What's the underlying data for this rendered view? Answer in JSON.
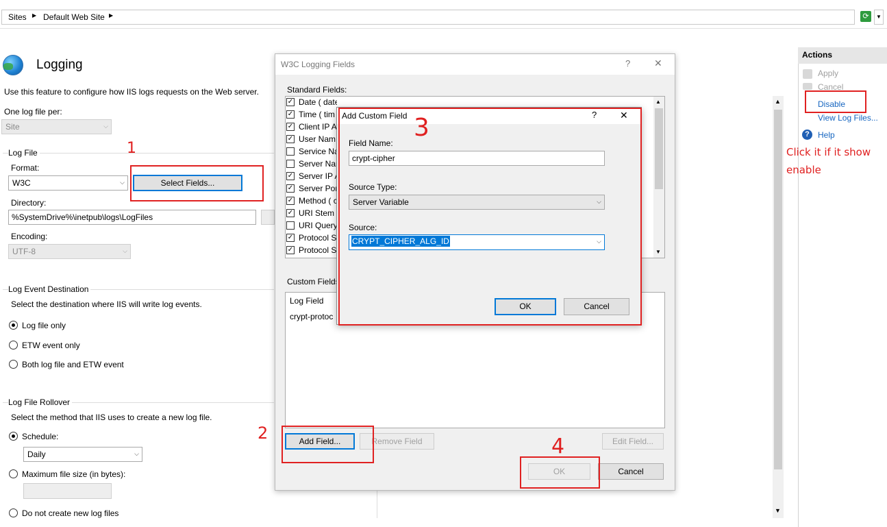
{
  "breadcrumb": [
    "Sites",
    "Default Web Site"
  ],
  "page": {
    "title": "Logging",
    "description": "Use this feature to configure how IIS logs requests on the Web server.",
    "one_log_file_per_label": "One log file per:",
    "one_log_file_per_value": "Site"
  },
  "log_file": {
    "section_title": "Log File",
    "format_label": "Format:",
    "format_value": "W3C",
    "select_fields_label": "Select Fields...",
    "directory_label": "Directory:",
    "directory_value": "%SystemDrive%\\inetpub\\logs\\LogFiles",
    "encoding_label": "Encoding:",
    "encoding_value": "UTF-8"
  },
  "log_event_destination": {
    "section_title": "Log Event Destination",
    "description": "Select the destination where IIS will write log events.",
    "options": [
      "Log file only",
      "ETW event only",
      "Both log file and ETW event"
    ],
    "selected": "Log file only"
  },
  "log_file_rollover": {
    "section_title": "Log File Rollover",
    "description": "Select the method that IIS uses to create a new log file.",
    "schedule_label": "Schedule:",
    "schedule_value": "Daily",
    "max_size_label": "Maximum file size (in bytes):",
    "max_size_value": "",
    "no_new_label": "Do not create new log files"
  },
  "w3c_dialog": {
    "title": "W3C Logging Fields",
    "help": "?",
    "close": "✕",
    "standard_fields_label": "Standard Fields:",
    "standard_fields": [
      {
        "label": "Date ( date )",
        "checked": true
      },
      {
        "label": "Time ( tim",
        "checked": true
      },
      {
        "label": "Client IP A",
        "checked": true
      },
      {
        "label": "User Nam",
        "checked": true
      },
      {
        "label": "Service Na",
        "checked": false
      },
      {
        "label": "Server Nan",
        "checked": false
      },
      {
        "label": "Server IP A",
        "checked": true
      },
      {
        "label": "Server Por",
        "checked": true
      },
      {
        "label": "Method ( c",
        "checked": true
      },
      {
        "label": "URI Stem (",
        "checked": true
      },
      {
        "label": "URI Query",
        "checked": false
      },
      {
        "label": "Protocol S",
        "checked": true
      },
      {
        "label": "Protocol S",
        "checked": true
      }
    ],
    "custom_fields_label": "Custom Fields",
    "custom_header": "Log Field",
    "custom_rows": [
      "crypt-protoc"
    ],
    "add_field": "Add Field...",
    "remove_field": "Remove Field",
    "edit_field": "Edit Field...",
    "ok": "OK",
    "cancel": "Cancel"
  },
  "add_custom_field_dialog": {
    "title": "Add Custom Field",
    "help": "?",
    "close": "✕",
    "field_name_label": "Field Name:",
    "field_name_value": "crypt-cipher",
    "source_type_label": "Source Type:",
    "source_type_value": "Server Variable",
    "source_label": "Source:",
    "source_value": "CRYPT_CIPHER_ALG_ID",
    "ok": "OK",
    "cancel": "Cancel"
  },
  "actions": {
    "header": "Actions",
    "apply": "Apply",
    "cancel": "Cancel",
    "disable": "Disable",
    "view_log_files": "View Log Files...",
    "help": "Help"
  },
  "annotations": {
    "n1": "1",
    "n2": "2",
    "n3": "3",
    "n4": "4",
    "note_line1": "Click it if it show",
    "note_line2": "enable"
  },
  "colors": {
    "annotation_red": "#e02020",
    "link_blue": "#1565c0",
    "focus_blue": "#0078d7",
    "selection_blue": "#0078d7"
  }
}
